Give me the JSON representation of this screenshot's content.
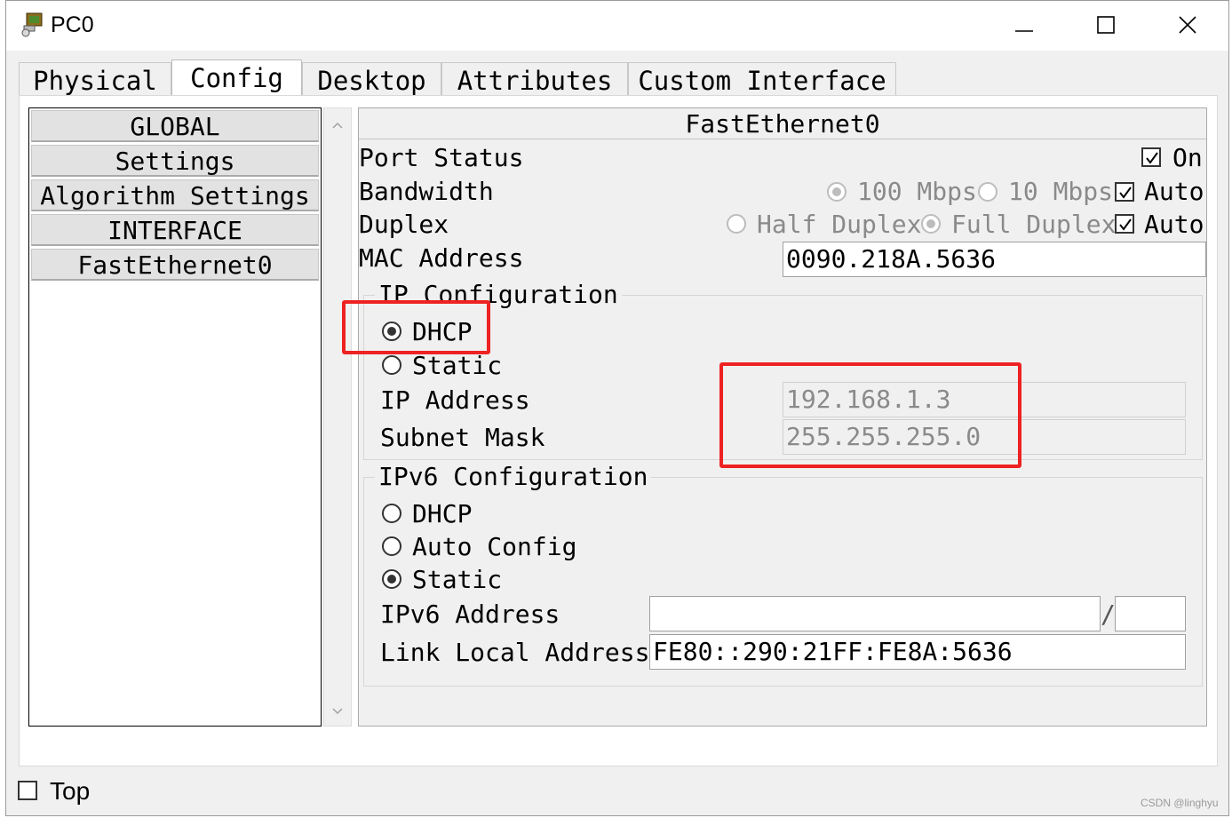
{
  "window": {
    "title": "PC0",
    "icon": "pc-icon"
  },
  "tabs": [
    "Physical",
    "Config",
    "Desktop",
    "Attributes",
    "Custom Interface"
  ],
  "active_tab": "Config",
  "sidebar": {
    "items": [
      "GLOBAL",
      "Settings",
      "Algorithm Settings",
      "INTERFACE",
      "FastEthernet0"
    ]
  },
  "interface": {
    "name": "FastEthernet0",
    "port_status": {
      "label": "Port Status",
      "on_label": "On",
      "on_checked": true
    },
    "bandwidth": {
      "label": "Bandwidth",
      "opt1": "100 Mbps",
      "opt2": "10 Mbps",
      "auto_label": "Auto",
      "auto_checked": true
    },
    "duplex": {
      "label": "Duplex",
      "opt1": "Half Duplex",
      "opt2": "Full Duplex",
      "auto_label": "Auto",
      "auto_checked": true
    },
    "mac": {
      "label": "MAC Address",
      "value": "0090.218A.5636"
    }
  },
  "ip_config": {
    "title": "IP Configuration",
    "dhcp_label": "DHCP",
    "static_label": "Static",
    "selected": "DHCP",
    "ip_label": "IP Address",
    "ip_value": "192.168.1.3",
    "mask_label": "Subnet Mask",
    "mask_value": "255.255.255.0"
  },
  "ipv6_config": {
    "title": "IPv6 Configuration",
    "dhcp_label": "DHCP",
    "auto_label": "Auto Config",
    "static_label": "Static",
    "selected": "Static",
    "addr_label": "IPv6 Address",
    "addr_value": "",
    "prefix_sep": "/",
    "prefix_value": "",
    "link_local_label": "Link Local Address:",
    "link_local_value": "FE80::290:21FF:FE8A:5636"
  },
  "footer": {
    "top_label": "Top",
    "top_checked": false
  },
  "watermark": "CSDN @linghyu",
  "colors": {
    "highlight": "#ee2222",
    "window_bg": "#f0f0f0"
  }
}
